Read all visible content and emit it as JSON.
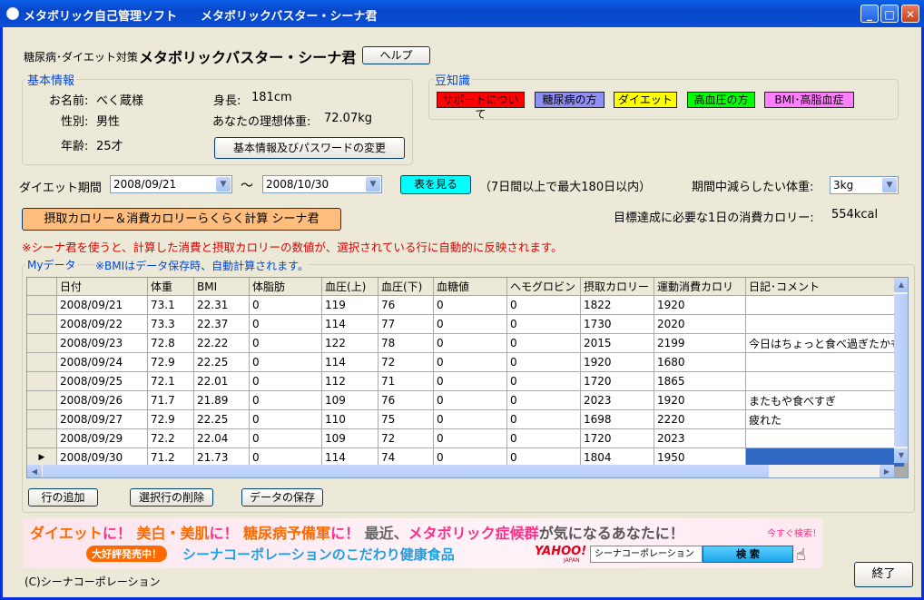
{
  "window": {
    "title": "メタボリック自己管理ソフト　　メタボリックバスター・シーナ君"
  },
  "header": {
    "subtitle": "糖尿病･ダイエット対策",
    "app_name": "メタボリックバスター・シーナ君",
    "help_label": "ヘルプ"
  },
  "basic": {
    "legend": "基本情報",
    "name_label": "お名前:",
    "name_value": "べく蔵様",
    "gender_label": "性別:",
    "gender_value": "男性",
    "age_label": "年齢:",
    "age_value": "25才",
    "height_label": "身長:",
    "height_value": "181cm",
    "ideal_label": "あなたの理想体重:",
    "ideal_value": "72.07kg",
    "change_button": "基本情報及びパスワードの変更"
  },
  "tips": {
    "legend": "豆知識",
    "buttons": [
      {
        "label": "サポートについて",
        "color": "#ff0000"
      },
      {
        "label": "糖尿病の方",
        "color": "#8f8ff2"
      },
      {
        "label": "ダイエット",
        "color": "#ffff00"
      },
      {
        "label": "高血圧の方",
        "color": "#00ff00"
      },
      {
        "label": "BMI･高脂血症",
        "color": "#ff80ff"
      }
    ]
  },
  "period": {
    "label": "ダイエット期間",
    "start": "2008/09/21",
    "tilde": "～",
    "end": "2008/10/30",
    "show_button": "表を見る",
    "note": "（7日間以上で最大180日以内）",
    "target_label": "期間中減らしたい体重:",
    "target_value": "3kg"
  },
  "calc": {
    "button": "摂取カロリー＆消費カロリーらくらく計算 シーナ君",
    "needed_label": "目標達成に必要な1日の消費カロリー:",
    "needed_value": "554kcal"
  },
  "notice": "※シーナ君を使うと、計算した消費と摂取カロリーの数値が、選択されている行に自動的に反映されます。",
  "mydata": {
    "legend": "Myデータ",
    "note": "※BMIはデータ保存時、自動計算されます。",
    "columns": [
      "日付",
      "体重",
      "BMI",
      "体脂肪",
      "血圧(上)",
      "血圧(下)",
      "血糖値",
      "ヘモグロビン",
      "摂取カロリー",
      "運動消費カロリ",
      "日記･コメント"
    ],
    "rows": [
      [
        "2008/09/21",
        "73.1",
        "22.31",
        "0",
        "119",
        "76",
        "0",
        "0",
        "1822",
        "1920",
        ""
      ],
      [
        "2008/09/22",
        "73.3",
        "22.37",
        "0",
        "114",
        "77",
        "0",
        "0",
        "1730",
        "2020",
        ""
      ],
      [
        "2008/09/23",
        "72.8",
        "22.22",
        "0",
        "122",
        "78",
        "0",
        "0",
        "2015",
        "2199",
        "今日はちょっと食べ過ぎたかも"
      ],
      [
        "2008/09/24",
        "72.9",
        "22.25",
        "0",
        "114",
        "72",
        "0",
        "0",
        "1920",
        "1680",
        ""
      ],
      [
        "2008/09/25",
        "72.1",
        "22.01",
        "0",
        "112",
        "71",
        "0",
        "0",
        "1720",
        "1865",
        ""
      ],
      [
        "2008/09/26",
        "71.7",
        "21.89",
        "0",
        "109",
        "76",
        "0",
        "0",
        "2023",
        "1920",
        "またもや食べすぎ"
      ],
      [
        "2008/09/27",
        "72.9",
        "22.25",
        "0",
        "110",
        "75",
        "0",
        "0",
        "1698",
        "2220",
        "疲れた"
      ],
      [
        "2008/09/29",
        "72.2",
        "22.04",
        "0",
        "109",
        "72",
        "0",
        "0",
        "1720",
        "2023",
        ""
      ],
      [
        "2008/09/30",
        "71.2",
        "21.73",
        "0",
        "114",
        "74",
        "0",
        "0",
        "1804",
        "1950",
        ""
      ]
    ],
    "add_row": "行の追加",
    "delete_row": "選択行の削除",
    "save": "データの保存"
  },
  "banner": {
    "line1_a": "ダイエット",
    "line1_b": "に！",
    "line1_c": "美白・美肌",
    "line1_d": "に！",
    "line1_e": "糖尿病予備軍",
    "line1_f": "に！",
    "line1_g": "最近、",
    "line1_h": "メタボリック症候群",
    "line1_i": "が気になるあなたに！",
    "search_now": "今すぐ検索！",
    "badge": "大好評発売中！",
    "line2": "シーナコーポレーションのこだわり健康食品",
    "yahoo": "YAHOO!",
    "yahoo_sub": "JAPAN",
    "search_text": "シーナコーポレーション",
    "search_button": "検 索"
  },
  "footer": {
    "copyright": "(C)シーナコーポレーション",
    "exit_button": "終了"
  }
}
